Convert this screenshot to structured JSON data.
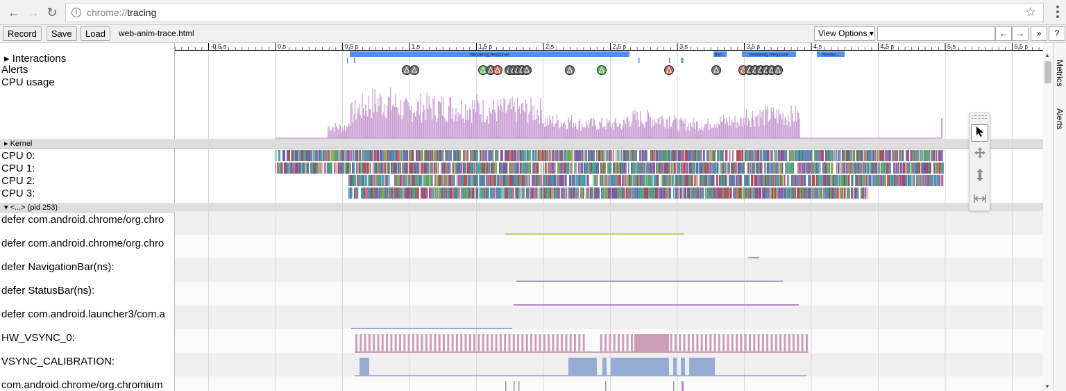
{
  "browser": {
    "url_scheme": "chrome://",
    "url_host": "tracing"
  },
  "toolbar": {
    "record_label": "Record",
    "save_label": "Save",
    "load_label": "Load",
    "trace_name": "web-anim-trace.html",
    "view_options_label": "View Options ▾",
    "search_placeholder": "",
    "prev_label": "←",
    "next_label": "→",
    "expand_label": "»",
    "help_label": "?"
  },
  "side_tabs": [
    "Metrics",
    "Alerts"
  ],
  "ruler": {
    "ticks": [
      "-0.5 s",
      "0 s",
      "0.5 s",
      "1 s",
      "1.5 s",
      "2 s",
      "2.5 s",
      "3 s",
      "3.5 s",
      "4 s",
      "4.5 s",
      "5 s",
      "5.5 s"
    ]
  },
  "tracks": {
    "interactions": "▸  Interactions",
    "alerts": "Alerts",
    "cpu_usage": "CPU usage",
    "kernel_header": "▸ Kernel",
    "cpus": [
      "CPU 0:",
      "CPU 1:",
      "CPU 2:",
      "CPU 3:"
    ],
    "process_header": "▾ <...> (pid 253)",
    "threads": [
      "defer com.android.chrome/org.chro",
      "defer com.android.chrome/org.chro",
      "defer NavigationBar(ns):",
      "defer StatusBar(ns):",
      "defer com.android.launcher3/com.a",
      "HW_VSYNC_0:",
      "VSYNC_CALIBRATION:",
      "com.android.chrome/org.chromium"
    ]
  },
  "interaction_slices": [
    "Rendering Response",
    "Ren...",
    "Rendering Response",
    "Render..."
  ],
  "colors": {
    "interaction": "#4f8ff0",
    "cpu_usage": "#c89ad2",
    "hw_vsync": "#cc9eb4",
    "vsync_calibration": "#97acd3",
    "green_line": "#b6d27a",
    "purple_line": "#b78ac3"
  },
  "mode_icons": [
    "pointer-icon",
    "pan-icon",
    "zoom-icon",
    "timing-icon"
  ]
}
